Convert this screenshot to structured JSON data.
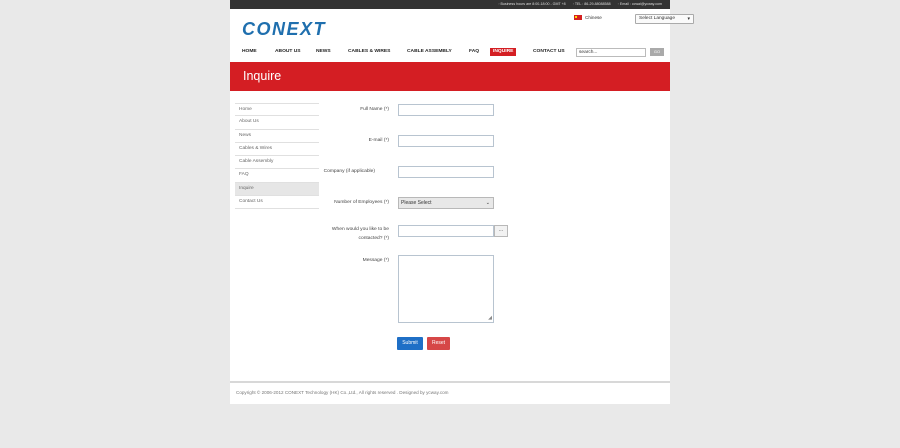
{
  "topbar": {
    "hours": "Business hours are 8:00-18:00 - GMT +8",
    "tel": "TEL : 86-29-88088588",
    "email": "Email : ccwai@ycway.com"
  },
  "brand": {
    "logo": "CONEXT"
  },
  "language": {
    "label": "Chinese",
    "select": "Select Language"
  },
  "nav": {
    "items": [
      "HOME",
      "ABOUT US",
      "NEWS",
      "CABLES & WIRES",
      "CABLE ASSEMBLY",
      "FAQ",
      "INQUIRE",
      "CONTACT US"
    ],
    "active": "INQUIRE"
  },
  "search": {
    "value": "search...",
    "go": "GO"
  },
  "banner": {
    "title": "Inquire"
  },
  "sidebar": {
    "items": [
      "Home",
      "About Us",
      "News",
      "Cables & Wires",
      "Cable Assembly",
      "FAQ",
      "Inquire",
      "Contact Us"
    ],
    "active": "Inquire"
  },
  "form": {
    "full_name_label": "Full Name (*)",
    "email_label": "E-mail (*)",
    "company_label": "Company (if applicable)",
    "employees_label": "Number of Employees (*)",
    "employees_value": "Please Select",
    "contact_label_1": "When would you like to be",
    "contact_label_2": "contacted? (*)",
    "picker_label": "...",
    "message_label": "Message (*)",
    "submit": "Submit",
    "reset": "Reset"
  },
  "footer": {
    "copyright": "Copyright © 2006-2012 CONEXT Technology (HK) Co.,Ltd., All rights reserved . Designed by ycway.com"
  },
  "colors": {
    "accent": "#d41e23",
    "brand": "#1f6fae",
    "submit": "#1f6fc6",
    "reset": "#d64747"
  }
}
